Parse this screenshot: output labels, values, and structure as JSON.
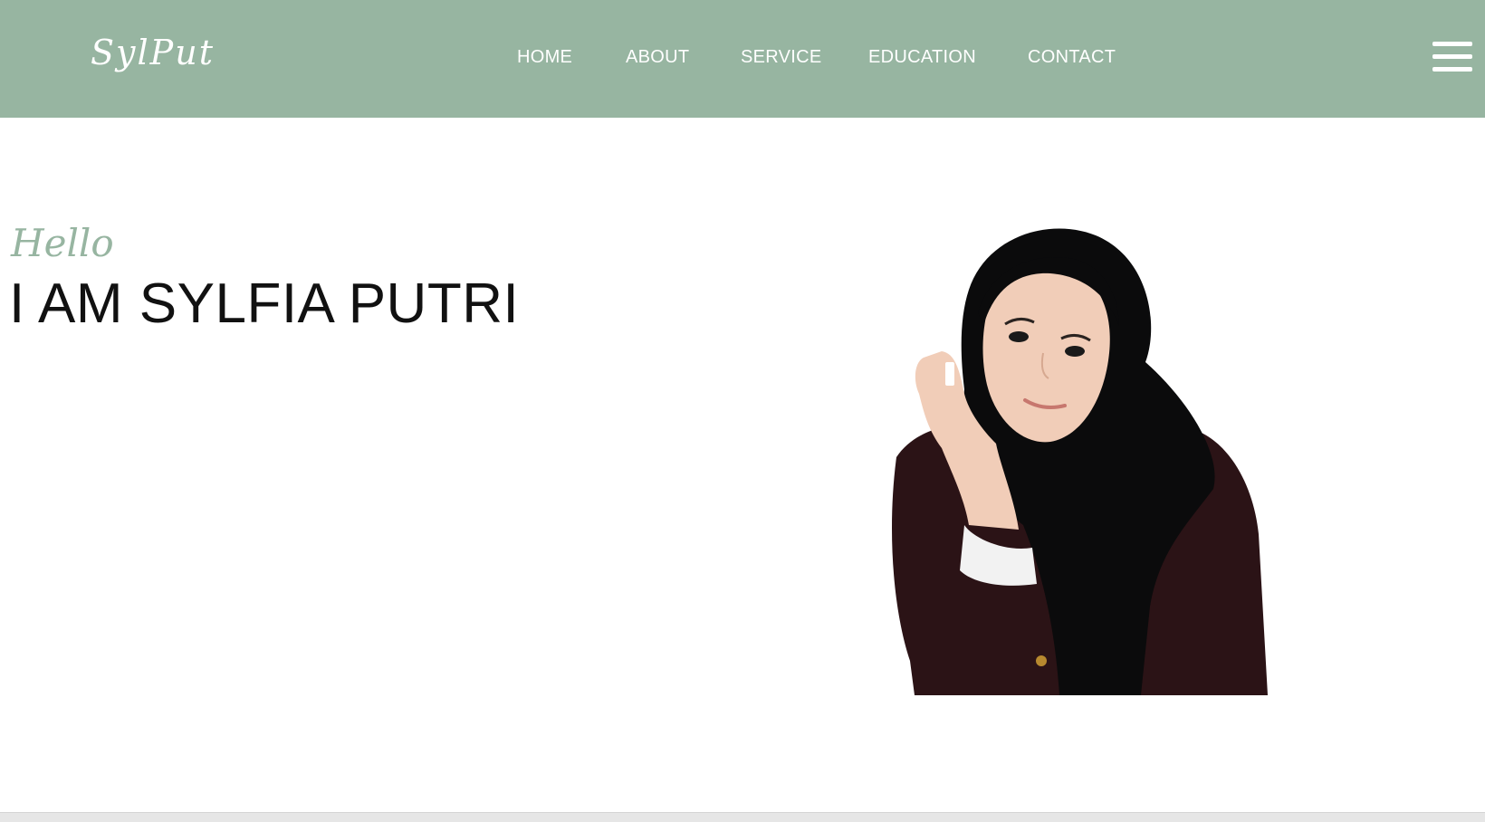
{
  "brand": {
    "logo": "SylPut"
  },
  "nav": {
    "items": [
      {
        "label": "HOME"
      },
      {
        "label": "ABOUT"
      },
      {
        "label": "SERVICE"
      },
      {
        "label": "EDUCATION"
      },
      {
        "label": "CONTACT"
      }
    ],
    "menu_icon": "hamburger-menu-icon"
  },
  "hero": {
    "greeting": "Hello",
    "title": "I AM SYLFIA PUTRI",
    "image": "portrait-photo"
  },
  "colors": {
    "nav_background": "#97b5a1",
    "accent": "#97b5a1",
    "nav_text": "#ffffff",
    "title_text": "#111111"
  }
}
